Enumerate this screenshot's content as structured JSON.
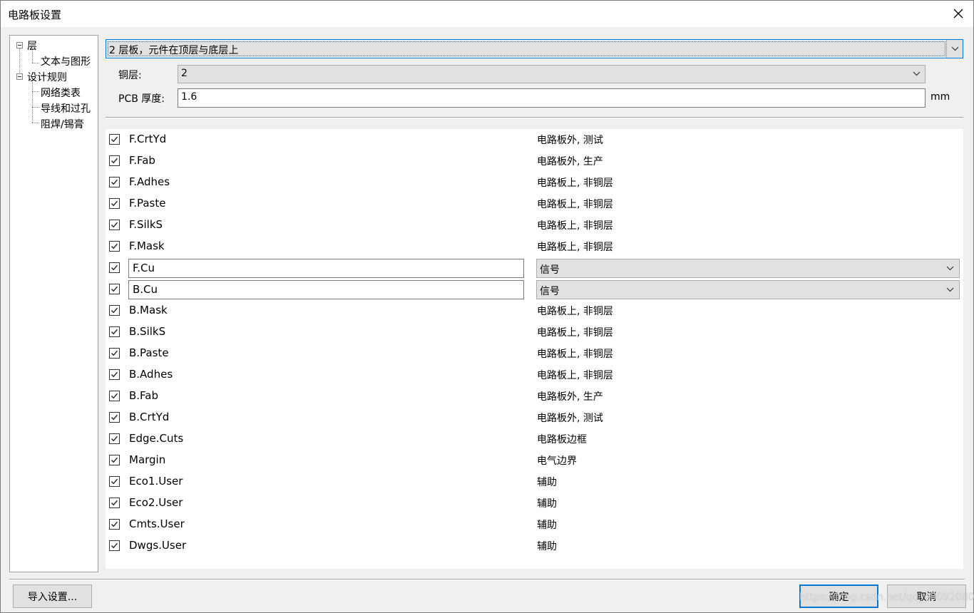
{
  "window": {
    "title": "电路板设置",
    "close_icon": "close-icon"
  },
  "tree": {
    "items": [
      {
        "label": "层",
        "expanded": true
      },
      {
        "label": "文本与图形"
      },
      {
        "label": "设计规则",
        "expanded": true
      },
      {
        "label": "网络类表"
      },
      {
        "label": "导线和过孔"
      },
      {
        "label": "阻焊/锡膏"
      }
    ]
  },
  "board": {
    "preset_value": "2 层板，元件在顶层与底层上",
    "copper_label": "铜层:",
    "copper_value": "2",
    "thickness_label": "PCB 厚度:",
    "thickness_value": "1.6",
    "thickness_unit": "mm"
  },
  "layers": [
    {
      "name": "F.CrtYd",
      "type": "电路板外, 测试",
      "checked": true
    },
    {
      "name": "F.Fab",
      "type": "电路板外, 生产",
      "checked": true
    },
    {
      "name": "F.Adhes",
      "type": "电路板上, 非铜层",
      "checked": true
    },
    {
      "name": "F.Paste",
      "type": "电路板上, 非铜层",
      "checked": true
    },
    {
      "name": "F.SilkS",
      "type": "电路板上, 非铜层",
      "checked": true
    },
    {
      "name": "F.Mask",
      "type": "电路板上, 非铜层",
      "checked": true
    },
    {
      "name": "F.Cu",
      "type": "信号",
      "checked": true,
      "editable": true
    },
    {
      "name": "B.Cu",
      "type": "信号",
      "checked": true,
      "editable": true
    },
    {
      "name": "B.Mask",
      "type": "电路板上, 非铜层",
      "checked": true
    },
    {
      "name": "B.SilkS",
      "type": "电路板上, 非铜层",
      "checked": true
    },
    {
      "name": "B.Paste",
      "type": "电路板上, 非铜层",
      "checked": true
    },
    {
      "name": "B.Adhes",
      "type": "电路板上, 非铜层",
      "checked": true
    },
    {
      "name": "B.Fab",
      "type": "电路板外, 生产",
      "checked": true
    },
    {
      "name": "B.CrtYd",
      "type": "电路板外, 测试",
      "checked": true
    },
    {
      "name": "Edge.Cuts",
      "type": "电路板边框",
      "checked": true
    },
    {
      "name": "Margin",
      "type": "电气边界",
      "checked": true
    },
    {
      "name": "Eco1.User",
      "type": "辅助",
      "checked": true
    },
    {
      "name": "Eco2.User",
      "type": "辅助",
      "checked": true
    },
    {
      "name": "Cmts.User",
      "type": "辅助",
      "checked": true
    },
    {
      "name": "Dwgs.User",
      "type": "辅助",
      "checked": true
    }
  ],
  "buttons": {
    "import_label": "导入设置...",
    "ok_label": "确定",
    "cancel_label": "取消"
  },
  "watermark": "https://blog.csdn.net/qq_40092080",
  "colors": {
    "accent": "#0078d7",
    "button_bg": "#e1e1e1",
    "window_bg": "#f0f0f0"
  }
}
